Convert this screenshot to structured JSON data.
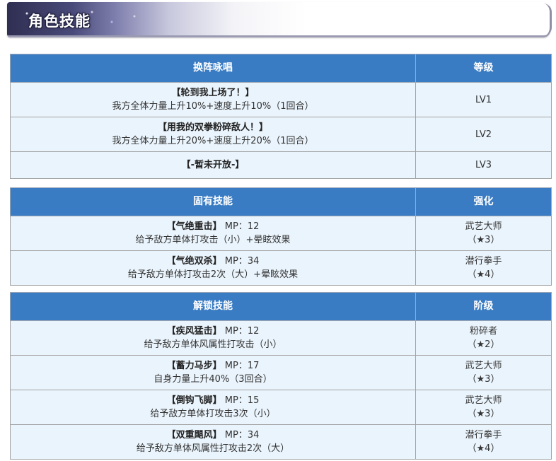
{
  "section": {
    "title": "角色技能"
  },
  "chant": {
    "headers": {
      "skill": "换阵咏唱",
      "level": "等级"
    },
    "rows": [
      {
        "name": "【轮到我上场了！】",
        "desc": "我方全体力量上升10%+速度上升10%（1回合）",
        "level": "LV1"
      },
      {
        "name": "【用我的双拳粉碎敌人！】",
        "desc": "我方全体力量上升20%+速度上升20%（1回合）",
        "level": "LV2"
      },
      {
        "name": "【-暂未开放-】",
        "level": "LV3"
      }
    ]
  },
  "innate": {
    "headers": {
      "skill": "固有技能",
      "level": "强化"
    },
    "rows": [
      {
        "name": "【气绝重击】",
        "mp": "MP：12",
        "desc": "给予敌方单体打攻击（小）+晕眩效果",
        "level_name": "武艺大师",
        "level_rank": "（★3）"
      },
      {
        "name": "【气绝双杀】",
        "mp": "MP：34",
        "desc": "给予敌方单体打攻击2次（大）+晕眩效果",
        "level_name": "潜行拳手",
        "level_rank": "（★4）"
      }
    ]
  },
  "unlock": {
    "headers": {
      "skill": "解锁技能",
      "level": "阶级"
    },
    "rows": [
      {
        "name": "【疾风猛击】",
        "mp": "MP：12",
        "desc": "给予敌方单体风属性打攻击（小）",
        "level_name": "粉碎者",
        "level_rank": "（★2）"
      },
      {
        "name": "【蓄力马步】",
        "mp": "MP：17",
        "desc": "自身力量上升40%（3回合）",
        "level_name": "武艺大师",
        "level_rank": "（★3）"
      },
      {
        "name": "【倒钩飞脚】",
        "mp": "MP：15",
        "desc": "给予敌方单体打攻击3次（小）",
        "level_name": "武艺大师",
        "level_rank": "（★3）"
      },
      {
        "name": "【双重飓风】",
        "mp": "MP：34",
        "desc": "给予敌方单体风属性打攻击2次（大）",
        "level_name": "潜行拳手",
        "level_rank": "（★4）"
      }
    ]
  },
  "colors": {
    "header_bg": "#3a7cc3",
    "cell_bg": "#eaf4fc",
    "border": "#a3a3a3"
  }
}
